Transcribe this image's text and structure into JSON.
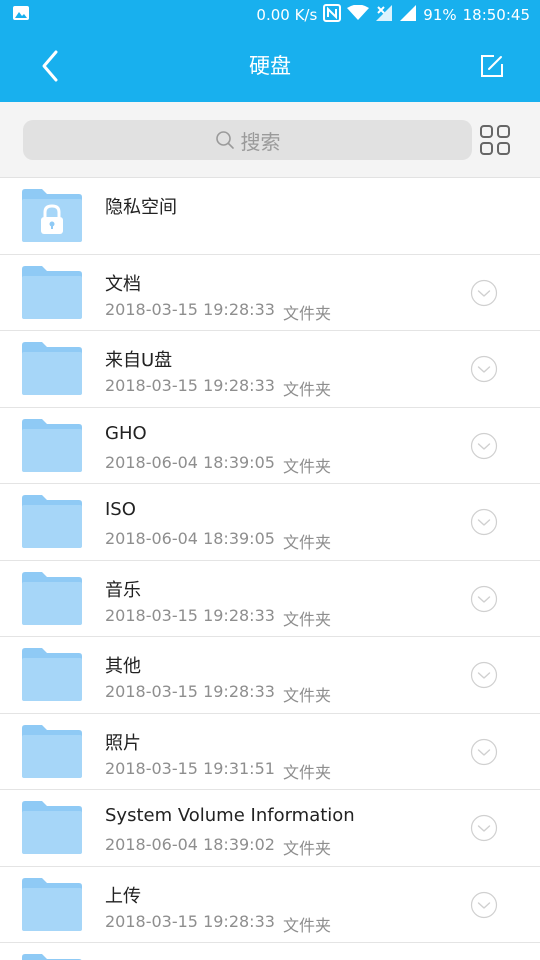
{
  "status": {
    "speed": "0.00 K/s",
    "battery": "91%",
    "time": "18:50:45"
  },
  "header": {
    "title": "硬盘"
  },
  "search": {
    "placeholder": "搜索"
  },
  "private_space": {
    "name": "隐私空间"
  },
  "items": [
    {
      "name": "文档",
      "date": "2018-03-15 19:28:33",
      "kind": "文件夹"
    },
    {
      "name": "来自U盘",
      "date": "2018-03-15 19:28:33",
      "kind": "文件夹"
    },
    {
      "name": "GHO",
      "date": "2018-06-04 18:39:05",
      "kind": "文件夹"
    },
    {
      "name": "ISO",
      "date": "2018-06-04 18:39:05",
      "kind": "文件夹"
    },
    {
      "name": "音乐",
      "date": "2018-03-15 19:28:33",
      "kind": "文件夹"
    },
    {
      "name": "其他",
      "date": "2018-03-15 19:28:33",
      "kind": "文件夹"
    },
    {
      "name": "照片",
      "date": "2018-03-15 19:31:51",
      "kind": "文件夹"
    },
    {
      "name": "System Volume Information",
      "date": "2018-06-04 18:39:02",
      "kind": "文件夹"
    },
    {
      "name": "上传",
      "date": "2018-03-15 19:28:33",
      "kind": "文件夹"
    }
  ],
  "colors": {
    "accent": "#18b0ee",
    "folder": "#8fcaf5"
  }
}
